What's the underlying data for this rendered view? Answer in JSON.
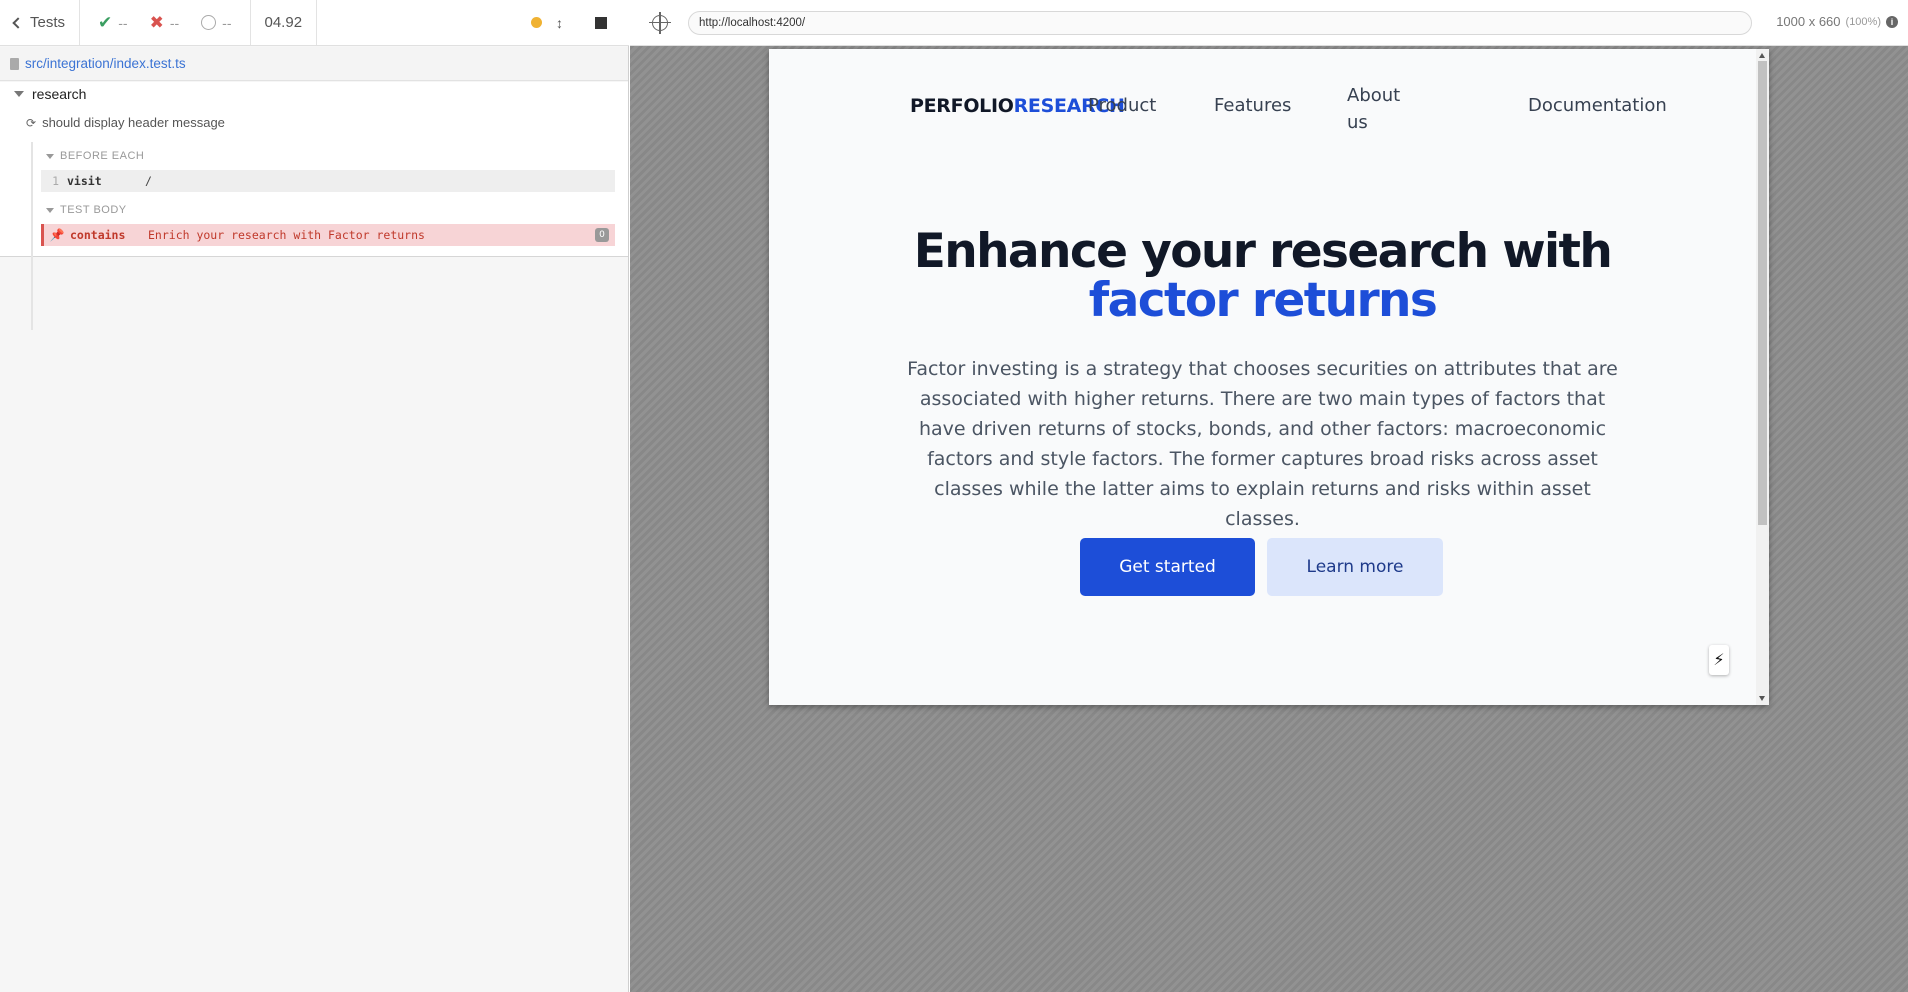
{
  "reporter": {
    "header": {
      "tests_label": "Tests",
      "passed": "--",
      "failed": "--",
      "pending": "--",
      "duration": "04.92"
    },
    "spec_file": "src/integration/index.test.ts",
    "suite_title": "research",
    "test_title": "should display header message",
    "hooks": [
      {
        "label": "BEFORE EACH",
        "commands": [
          {
            "number": "1",
            "name": "visit",
            "message": "/"
          }
        ]
      },
      {
        "label": "TEST BODY",
        "commands": [
          {
            "name": "contains",
            "message": "Enrich your research with Factor returns",
            "badge": "0"
          }
        ]
      }
    ]
  },
  "aut": {
    "url": "http://localhost:4200/",
    "viewport_size": "1000 x 660",
    "viewport_scale": "(100%)"
  },
  "site": {
    "logo_part1": "PERFOLIO",
    "logo_part2": "RESEARCH",
    "nav": [
      "Product",
      "Features",
      "About us",
      "Documentation"
    ],
    "hero_title_line1": "Enhance your research with",
    "hero_title_line2": "factor returns",
    "hero_description": "Factor investing is a strategy that chooses securities on attributes that are associated with higher returns. There are two main types of factors that have driven returns of stocks, bonds, and other factors: macroeconomic factors and style factors. The former captures broad risks across asset classes while the latter aims to explain returns and risks within asset classes.",
    "cta_primary": "Get started",
    "cta_secondary": "Learn more"
  },
  "colors": {
    "brand_blue": "#1d4ed8",
    "pass_green": "#3a9e61",
    "fail_red": "#d9534f",
    "running_yellow": "#f0b232"
  },
  "icons": [
    "chevron-left-icon",
    "check-icon",
    "x-icon",
    "pending-circle-icon",
    "running-dot-icon",
    "auto-scroll-icon",
    "stop-icon",
    "file-icon",
    "caret-down-icon",
    "refresh-icon",
    "pin-icon",
    "crosshair-icon",
    "info-icon",
    "lightning-bolt-icon"
  ]
}
